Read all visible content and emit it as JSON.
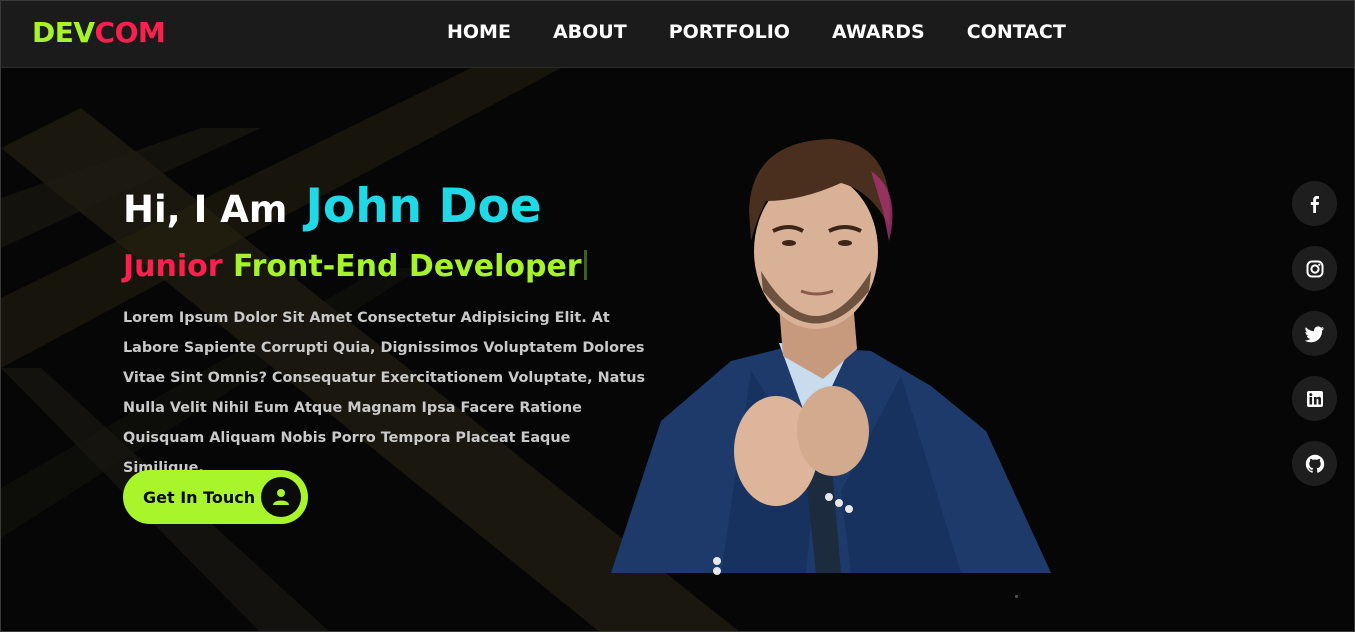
{
  "brand": {
    "part1": "DEV",
    "part2": "COM"
  },
  "nav": {
    "items": [
      "HOME",
      "ABOUT",
      "PORTFOLIO",
      "AWARDS",
      "CONTACT"
    ]
  },
  "hero": {
    "greeting": "Hi, I Am",
    "name": "John Doe",
    "role_prefix": "Junior",
    "role_main": "Front-End Developer",
    "bio": "Lorem Ipsum Dolor Sit Amet Consectetur Adipisicing Elit. At Labore Sapiente Corrupti Quia, Dignissimos Voluptatem Dolores Vitae Sint Omnis? Consequatur Exercitationem Voluptate, Natus Nulla Velit Nihil Eum Atque Magnam Ipsa Facere Ratione Quisquam Aliquam Nobis Porro Tempora Placeat Eaque Similique.",
    "cta_label": "Get In Touch",
    "cta_icon": "user-icon"
  },
  "social": [
    "facebook-icon",
    "instagram-icon",
    "twitter-icon",
    "linkedin-icon",
    "github-icon"
  ],
  "colors": {
    "accent_green": "#a6f32a",
    "accent_red": "#ff1f4e",
    "accent_cyan": "#1fd9e6",
    "background": "#060606",
    "header": "#1b1b1b"
  }
}
